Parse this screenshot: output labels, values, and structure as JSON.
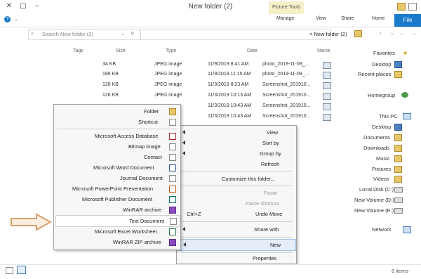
{
  "window": {
    "title": "New folder (2)",
    "picture_tools": "Picture Tools"
  },
  "ribbon": {
    "tabs": [
      "File",
      "Home",
      "Share",
      "View",
      "Manage"
    ]
  },
  "address": {
    "path": "New folder (2)",
    "search_placeholder": "Search New folder (2)"
  },
  "columns": {
    "name": "Name",
    "date": "Date",
    "type": "Type",
    "size": "Size",
    "tags": "Tags"
  },
  "files": [
    {
      "name": "photo_2019-11-09_...",
      "date": "11/9/2019 8:41 AM",
      "type": "JPEG image",
      "size": "34 KB"
    },
    {
      "name": "photo_2019-11-09_...",
      "date": "11/9/2019 11:15 AM",
      "type": "JPEG image",
      "size": "186 KB"
    },
    {
      "name": "Screenshot_201910...",
      "date": "11/3/2019 8:23 AM",
      "type": "JPEG image",
      "size": "128 KB"
    },
    {
      "name": "Screenshot_201910...",
      "date": "11/3/2019 10:13 AM",
      "type": "JPEG image",
      "size": "126 KB"
    },
    {
      "name": "Screenshot_201910...",
      "date": "11/3/2019 10:43 AM",
      "type": "",
      "size": ""
    },
    {
      "name": "Screenshot_201910...",
      "date": "11/3/2019 10:43 AM",
      "type": "",
      "size": ""
    }
  ],
  "nav": {
    "favorites": "Favorites",
    "desktop": "Desktop",
    "recent": "Recent places",
    "homegroup": "Homegroup",
    "thispc": "This PC",
    "pc_items": [
      "Desktop",
      "Documents",
      "Downloads",
      "Music",
      "Pictures",
      "Videos",
      "Local Disk (C:)",
      "New Volume (D:)",
      "New Volume (E:)"
    ],
    "network": "Network"
  },
  "main_menu": {
    "view": "View",
    "sortby": "Sort by",
    "groupby": "Group by",
    "refresh": "Refresh",
    "customize": "Customize this folder...",
    "paste": "Paste",
    "paste_shortcut": "Paste shortcut",
    "undo": "Undo Move",
    "undo_shortcut": "Ctrl+Z",
    "share": "Share with",
    "new": "New",
    "properties": "Properties"
  },
  "new_menu": {
    "folder": "Folder",
    "shortcut": "Shortcut",
    "items": [
      "Microsoft Access Database",
      "Bitmap image",
      "Contact",
      "Microsoft Word Document",
      "Journal Document",
      "Microsoft PowerPoint Presentation",
      "Microsoft Publisher Document",
      "WinRAR archive",
      "Text Document",
      "Microsoft Excel Worksheet",
      "WinRAR ZIP archive"
    ]
  },
  "status": {
    "items": "6 items"
  },
  "colors": {
    "accent": "#1979ca",
    "highlight_arrow": "#d9a06a"
  }
}
